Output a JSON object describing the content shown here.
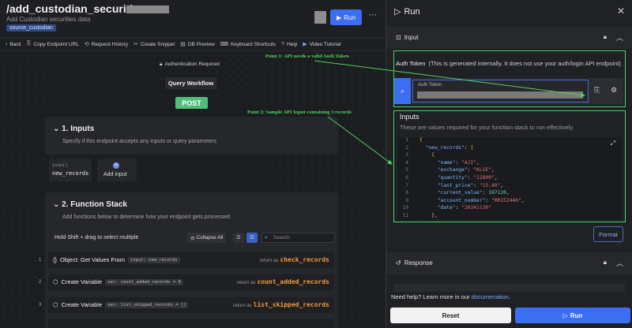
{
  "endpoint": {
    "title": "/add_custodian_securities",
    "subtitle": "Add Custodian securities data",
    "tag": "source_custodian",
    "run_label": "Run",
    "more": "⋯"
  },
  "toolbar": [
    {
      "icon": "‹",
      "label": "Back"
    },
    {
      "icon": "⎘",
      "label": "Copy Endpoint URL"
    },
    {
      "icon": "⟲",
      "label": "Request History"
    },
    {
      "icon": "✂",
      "label": "Create Snippet"
    },
    {
      "icon": "▤",
      "label": "DB Preview"
    },
    {
      "icon": "⌨",
      "label": "Keyboard Shortcuts"
    },
    {
      "icon": "?",
      "label": "Help"
    },
    {
      "icon": "▶",
      "label": "Video Tutorial"
    }
  ],
  "canvas": {
    "auth_required": "Authentication Required",
    "query_workflow": "Query Workflow",
    "method": "POST"
  },
  "inputs_card": {
    "title": "1. Inputs",
    "subtitle": "Specify if this endpoint accepts any inputs or query parameters",
    "input_type": "json[]",
    "input_name": "new_records",
    "add_label": "Add input"
  },
  "function_stack": {
    "title": "2. Function Stack",
    "subtitle": "Add functions below to determine how your endpoint gets processed",
    "hold_text": "Hold  Shift  + drag to select multiple",
    "collapse_label": "Collapse All",
    "search_placeholder": "Search",
    "return_prefix": "return as",
    "steps": [
      {
        "num": "1",
        "icon": "{}",
        "label": "Object: Get Values From",
        "code": "input: new_records",
        "ret": "check_records"
      },
      {
        "num": "2",
        "icon": "⬡",
        "label": "Create Variable",
        "code": "var: count_added_records  =  0",
        "ret": "count_added_records"
      },
      {
        "num": "3",
        "icon": "⬡",
        "label": "Create Variable",
        "code": "var: list_skipped_records  =  []",
        "ret": "list_skipped_records"
      }
    ]
  },
  "run_panel": {
    "title": "Run",
    "input_section": "Input",
    "auth_title": "Auth Token",
    "auth_note": "(This is generated internally. It does not use your auth/login API endpoint)",
    "auth_field_label": "Auth Token",
    "inputs_title": "Inputs",
    "inputs_sub": "These are values required for your function stack to run effectively.",
    "code_lines": [
      {
        "n": "1",
        "t": "{"
      },
      {
        "n": "2",
        "t": "  \"new_records\": ["
      },
      {
        "n": "3",
        "t": "    {"
      },
      {
        "n": "4",
        "t": "      \"name\": \"AJI\","
      },
      {
        "n": "5",
        "t": "      \"exchange\": \"KLSE\","
      },
      {
        "n": "6",
        "t": "      \"quantity\": \"12800\","
      },
      {
        "n": "7",
        "t": "      \"last_price\": \"15.40\","
      },
      {
        "n": "8",
        "t": "      \"current_value\": 197120,"
      },
      {
        "n": "9",
        "t": "      \"account_number\": \"M0152446\","
      },
      {
        "n": "10",
        "t": "      \"date\": \"20241130\""
      },
      {
        "n": "11",
        "t": "    },"
      }
    ],
    "format_label": "Format",
    "response_section": "Response",
    "help_text": "Need help? Learn more in our",
    "help_link": "documenation",
    "help_end": ".",
    "reset_label": "Reset",
    "run_label": "Run"
  },
  "annotations": {
    "point1": "Point 1: API needs a valid Auth Token",
    "point2": "Point 2: Sample API Input containing 3 records"
  },
  "colors": {
    "accent": "#3b6ef0",
    "post": "#4fbe7b",
    "annotation": "#4bd15e",
    "return_var": "#f09a3e"
  }
}
